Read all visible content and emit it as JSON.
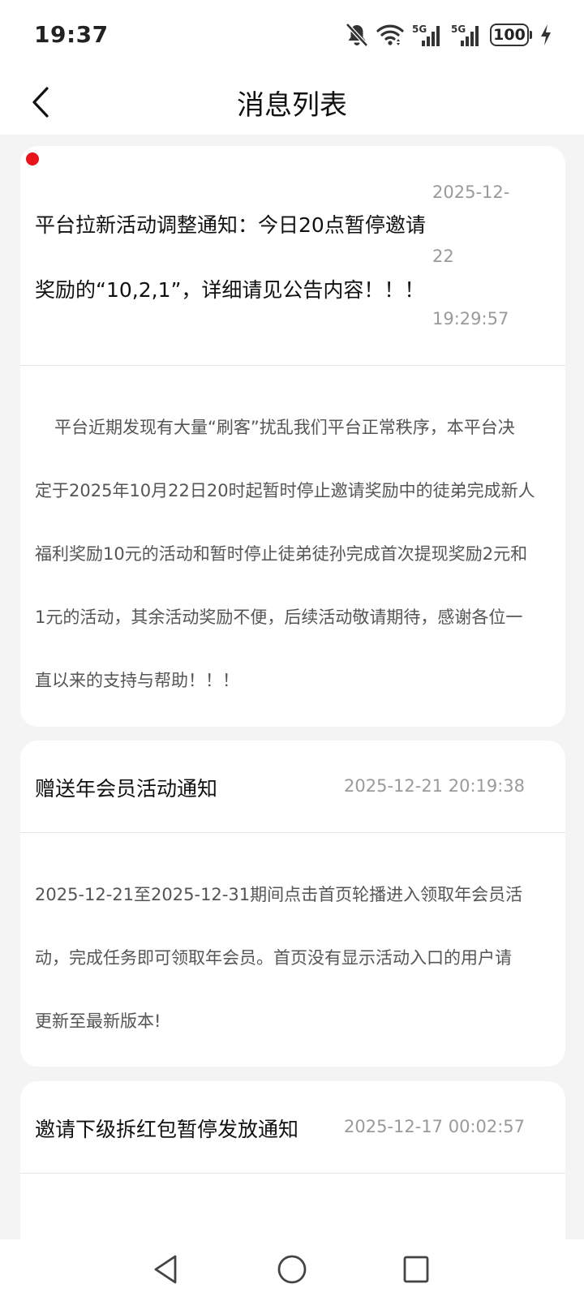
{
  "status_bar": {
    "time": "19:37",
    "battery": "100",
    "network_1": "5G",
    "network_2": "5G",
    "icons": [
      "bell-muted-icon",
      "wifi-icon",
      "signal-5g-icon",
      "signal-5g-icon",
      "battery-icon",
      "charging-icon"
    ]
  },
  "header": {
    "title": "消息列表",
    "back_icon": "chevron-left-icon"
  },
  "messages": [
    {
      "unread": true,
      "title_line1": "平台拉新活动调整通知：今日20点暂停邀请",
      "title_line2": "奖励的“10,2,1”，详细请见公告内容！！！",
      "time_line1": "2025-12-",
      "time_line2": "22",
      "time_line3": "19:29:57",
      "body_lines": [
        "平台近期发现有大量“刷客”扰乱我们平台正常秩序，本平台决",
        "定于2025年10月22日20时起暂时停止邀请奖励中的徒弟完成新人",
        "福利奖励10元的活动和暂时停止徒弟徒孙完成首次提现奖励2元和",
        "1元的活动，其余活动奖励不便，后续活动敬请期待，感谢各位一",
        "直以来的支持与帮助！！！"
      ]
    },
    {
      "unread": false,
      "title": "赠送年会员活动通知",
      "time": "2025-12-21 20:19:38",
      "body_lines": [
        "2025-12-21至2025-12-31期间点击首页轮播进入领取年会员活",
        "动，完成任务即可领取年会员。首页没有显示活动入口的用户请",
        "更新至最新版本!"
      ]
    },
    {
      "unread": false,
      "title": "邀请下级拆红包暂停发放通知",
      "time": "2025-12-17 00:02:57"
    }
  ],
  "system_nav": {
    "icons": [
      "back-triangle-icon",
      "home-circle-icon",
      "recents-square-icon"
    ]
  },
  "colors": {
    "background": "#f4f4f4",
    "card": "#ffffff",
    "unread_dot": "#e8141a",
    "time_text": "#9a9a9a",
    "body_text": "#555555"
  }
}
